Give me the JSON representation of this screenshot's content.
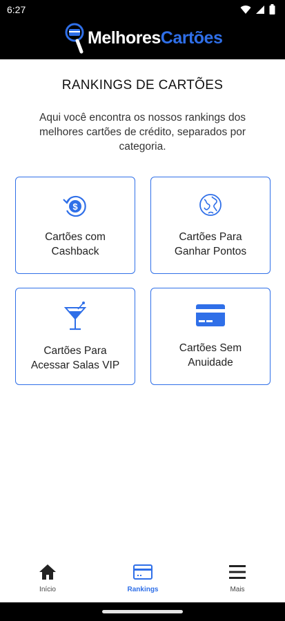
{
  "status": {
    "time": "6:27",
    "icons": [
      "wifi-icon",
      "signal-icon",
      "battery-icon"
    ]
  },
  "header": {
    "logo_part1": "Melhores",
    "logo_part2": "Cartões",
    "logo_icon": "magnifier-card-icon"
  },
  "page": {
    "title": "RANKINGS DE CARTÕES",
    "intro": "Aqui você encontra os nossos rankings dos melhores cartões de crédito, separados por categoria."
  },
  "cards": [
    {
      "line1": "Cartões com",
      "line2": "Cashback",
      "icon": "cashback-icon"
    },
    {
      "line1": "Cartões Para",
      "line2": "Ganhar Pontos",
      "icon": "globe-icon"
    },
    {
      "line1": "Cartões Para",
      "line2": "Acessar Salas VIP",
      "icon": "cocktail-icon"
    },
    {
      "line1": "Cartões Sem",
      "line2": "Anuidade",
      "icon": "credit-card-icon"
    }
  ],
  "nav": {
    "items": [
      {
        "label": "Início",
        "icon": "home-icon"
      },
      {
        "label": "Rankings",
        "icon": "card-icon",
        "active": true
      },
      {
        "label": "Mais",
        "icon": "menu-icon"
      }
    ]
  },
  "colors": {
    "accent": "#2f6fe8",
    "header_bg": "#000000"
  }
}
